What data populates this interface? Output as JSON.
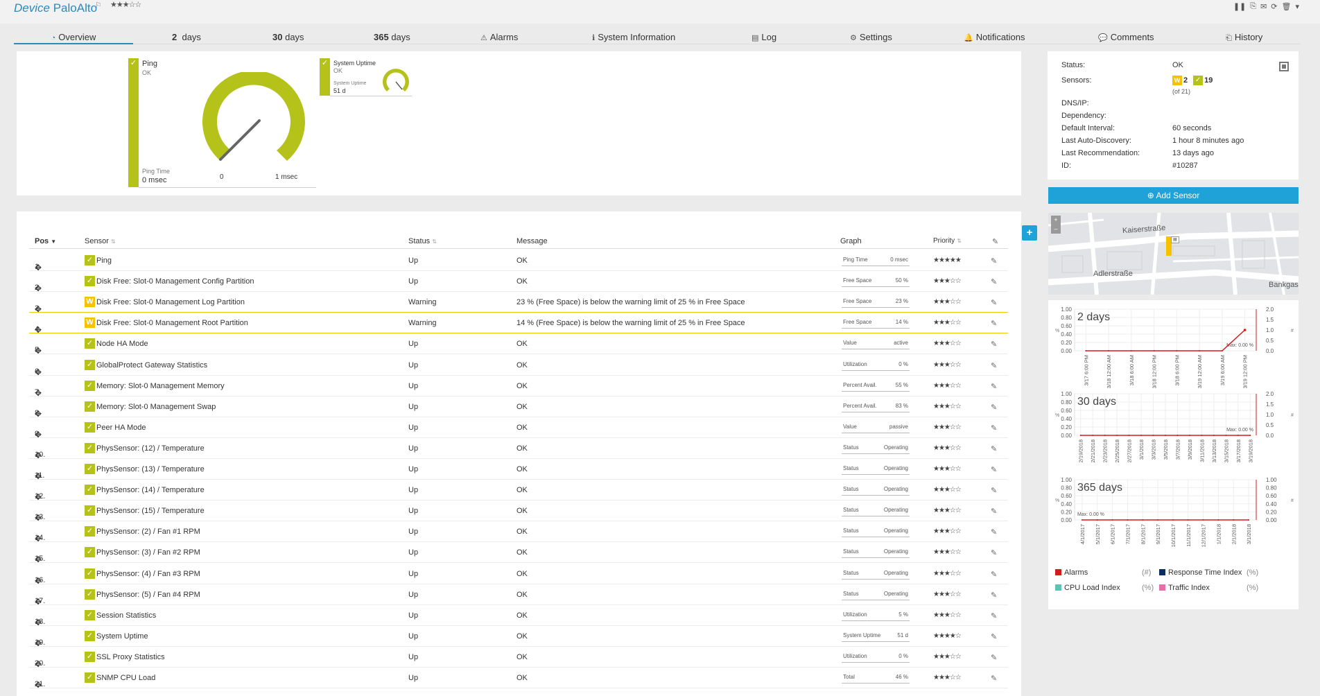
{
  "header": {
    "type_label": "Device",
    "device_name": "PaloAlto",
    "stars": "★★★☆☆",
    "tools": [
      "❚❚",
      "⎘",
      "✉",
      "⟳",
      "🗑",
      "▾"
    ]
  },
  "tabs": [
    {
      "icon": "◔",
      "label": "Overview"
    },
    {
      "icon": "",
      "num": "2",
      "label": "days"
    },
    {
      "icon": "",
      "num": "30",
      "label": "days"
    },
    {
      "icon": "",
      "num": "365",
      "label": "days"
    },
    {
      "icon": "⚠",
      "label": "Alarms"
    },
    {
      "icon": "ℹ",
      "label": "System Information"
    },
    {
      "icon": "▤",
      "label": "Log"
    },
    {
      "icon": "⚙",
      "label": "Settings"
    },
    {
      "icon": "🔔",
      "label": "Notifications"
    },
    {
      "icon": "💬",
      "label": "Comments"
    },
    {
      "icon": "⎗",
      "label": "History"
    }
  ],
  "gauges": {
    "ping": {
      "title": "Ping",
      "status": "OK",
      "channel": "Ping Time",
      "value": "0 msec",
      "min": "0",
      "max": "1 msec"
    },
    "uptime": {
      "title": "System Uptime",
      "status": "OK",
      "channel": "System Uptime",
      "value": "51 d"
    }
  },
  "table": {
    "headers": {
      "pos": "Pos",
      "sensor": "Sensor",
      "status": "Status",
      "message": "Message",
      "graph": "Graph",
      "priority": "Priority"
    },
    "rows": [
      {
        "pos": "1.",
        "state": "up",
        "name": "Ping",
        "status": "Up",
        "message": "OK",
        "channel": "Ping Time",
        "value": "0 msec",
        "prio": "★★★★★"
      },
      {
        "pos": "2.",
        "state": "up",
        "name": "Disk Free: Slot-0 Management Config Partition",
        "status": "Up",
        "message": "OK",
        "channel": "Free Space",
        "value": "50 %",
        "prio": "★★★☆☆"
      },
      {
        "pos": "3.",
        "state": "warning",
        "name": "Disk Free: Slot-0 Management Log Partition",
        "status": "Warning",
        "message": "23 % (Free Space) is below the warning limit of 25 % in Free Space",
        "channel": "Free Space",
        "value": "23 %",
        "prio": "★★★☆☆"
      },
      {
        "pos": "4.",
        "state": "warning",
        "name": "Disk Free: Slot-0 Management Root Partition",
        "status": "Warning",
        "message": "14 % (Free Space) is below the warning limit of 25 % in Free Space",
        "channel": "Free Space",
        "value": "14 %",
        "prio": "★★★☆☆"
      },
      {
        "pos": "5.",
        "state": "up",
        "name": "Node HA Mode",
        "status": "Up",
        "message": "OK",
        "channel": "Value",
        "value": "active",
        "prio": "★★★☆☆"
      },
      {
        "pos": "6.",
        "state": "up",
        "name": "GlobalProtect Gateway Statistics",
        "status": "Up",
        "message": "OK",
        "channel": "Utilization",
        "value": "0 %",
        "prio": "★★★☆☆"
      },
      {
        "pos": "7.",
        "state": "up",
        "name": "Memory: Slot-0 Management Memory",
        "status": "Up",
        "message": "OK",
        "channel": "Percent Avail.",
        "value": "55 %",
        "prio": "★★★☆☆"
      },
      {
        "pos": "8.",
        "state": "up",
        "name": "Memory: Slot-0 Management Swap",
        "status": "Up",
        "message": "OK",
        "channel": "Percent Avail.",
        "value": "83 %",
        "prio": "★★★☆☆"
      },
      {
        "pos": "9.",
        "state": "up",
        "name": "Peer HA Mode",
        "status": "Up",
        "message": "OK",
        "channel": "Value",
        "value": "passive",
        "prio": "★★★☆☆"
      },
      {
        "pos": "10.",
        "state": "up",
        "name": "PhysSensor: (12) / Temperature",
        "status": "Up",
        "message": "OK",
        "channel": "Status",
        "value": "Operating",
        "prio": "★★★☆☆"
      },
      {
        "pos": "11.",
        "state": "up",
        "name": "PhysSensor: (13) / Temperature",
        "status": "Up",
        "message": "OK",
        "channel": "Status",
        "value": "Operating",
        "prio": "★★★☆☆"
      },
      {
        "pos": "12.",
        "state": "up",
        "name": "PhysSensor: (14) / Temperature",
        "status": "Up",
        "message": "OK",
        "channel": "Status",
        "value": "Operating",
        "prio": "★★★☆☆"
      },
      {
        "pos": "13.",
        "state": "up",
        "name": "PhysSensor: (15) / Temperature",
        "status": "Up",
        "message": "OK",
        "channel": "Status",
        "value": "Operating",
        "prio": "★★★☆☆"
      },
      {
        "pos": "14.",
        "state": "up",
        "name": "PhysSensor: (2) / Fan #1 RPM",
        "status": "Up",
        "message": "OK",
        "channel": "Status",
        "value": "Operating",
        "prio": "★★★☆☆"
      },
      {
        "pos": "15.",
        "state": "up",
        "name": "PhysSensor: (3) / Fan #2 RPM",
        "status": "Up",
        "message": "OK",
        "channel": "Status",
        "value": "Operating",
        "prio": "★★★☆☆"
      },
      {
        "pos": "16.",
        "state": "up",
        "name": "PhysSensor: (4) / Fan #3 RPM",
        "status": "Up",
        "message": "OK",
        "channel": "Status",
        "value": "Operating",
        "prio": "★★★☆☆"
      },
      {
        "pos": "17.",
        "state": "up",
        "name": "PhysSensor: (5) / Fan #4 RPM",
        "status": "Up",
        "message": "OK",
        "channel": "Status",
        "value": "Operating",
        "prio": "★★★☆☆"
      },
      {
        "pos": "18.",
        "state": "up",
        "name": "Session Statistics",
        "status": "Up",
        "message": "OK",
        "channel": "Utilization",
        "value": "5 %",
        "prio": "★★★☆☆"
      },
      {
        "pos": "19.",
        "state": "up",
        "name": "System Uptime",
        "status": "Up",
        "message": "OK",
        "channel": "System Uptime",
        "value": "51 d",
        "prio": "★★★★☆"
      },
      {
        "pos": "20.",
        "state": "up",
        "name": "SSL Proxy Statistics",
        "status": "Up",
        "message": "OK",
        "channel": "Utilization",
        "value": "0 %",
        "prio": "★★★☆☆"
      },
      {
        "pos": "21.",
        "state": "up",
        "name": "SNMP CPU Load",
        "status": "Up",
        "message": "OK",
        "channel": "Total",
        "value": "46 %",
        "prio": "★★★☆☆"
      }
    ]
  },
  "info": {
    "status_label": "Status:",
    "status_value": "OK",
    "sensors_label": "Sensors:",
    "warn_count": "2",
    "up_count": "19",
    "of_total": "(of 21)",
    "dnsip_label": "DNS/IP:",
    "dependency_label": "Dependency:",
    "interval_label": "Default Interval:",
    "interval_value": "60 seconds",
    "autodisc_label": "Last Auto-Discovery:",
    "autodisc_value": "1 hour 8 minutes ago",
    "recommend_label": "Last Recommendation:",
    "recommend_value": "13 days ago",
    "id_label": "ID:",
    "id_value": "#10287"
  },
  "add_sensor_label": "Add Sensor",
  "map": {
    "street1": "Kaiserstraße",
    "street2": "Adlerstraße",
    "street3": "Bankgas"
  },
  "colors": {
    "up": "#b5c21a",
    "warning": "#f8c100",
    "accent": "#1fa2d8",
    "alarms": "#d7191c",
    "response": "#0b2d62",
    "cpu": "#56c6b5",
    "traffic": "#e66fa6"
  },
  "chart_data": [
    {
      "type": "line",
      "title": "2 days",
      "x": [
        "3/17 6:00 PM",
        "3/18 12:00 AM",
        "3/18 6:00 AM",
        "3/18 12:00 PM",
        "3/18 6:00 PM",
        "3/19 12:00 AM",
        "3/19 6:00 AM",
        "3/19 12:00 PM"
      ],
      "y_left_ticks": [
        "1.00",
        "0.80",
        "0.60",
        "0.40",
        "0.20",
        "0.00"
      ],
      "y_right_ticks": [
        "2.0",
        "1.5",
        "1.0",
        "0.5",
        "0.0"
      ],
      "ylabel_left": "%",
      "ylabel_right": "#",
      "max_label": "Max: 0.00 %",
      "series": [
        {
          "name": "Alarms",
          "values": [
            0,
            0,
            0,
            0,
            0,
            0,
            0,
            1
          ]
        }
      ]
    },
    {
      "type": "line",
      "title": "30 days",
      "x": [
        "2/19/2018",
        "2/21/2018",
        "2/23/2018",
        "2/25/2018",
        "2/27/2018",
        "3/1/2018",
        "3/3/2018",
        "3/5/2018",
        "3/7/2018",
        "3/9/2018",
        "3/11/2018",
        "3/13/2018",
        "3/15/2018",
        "3/17/2018",
        "3/19/2018"
      ],
      "y_left_ticks": [
        "1.00",
        "0.80",
        "0.60",
        "0.40",
        "0.20",
        "0.00"
      ],
      "y_right_ticks": [
        "2.0",
        "1.5",
        "1.0",
        "0.5",
        "0.0"
      ],
      "ylabel_left": "%",
      "ylabel_right": "#",
      "max_label": "Max: 0.00 %",
      "series": [
        {
          "name": "Alarms",
          "values": [
            0,
            0,
            0,
            0,
            0,
            0,
            0,
            0,
            0,
            0,
            0,
            0,
            0,
            0,
            0
          ]
        }
      ]
    },
    {
      "type": "line",
      "title": "365 days",
      "x": [
        "4/1/2017",
        "5/1/2017",
        "6/1/2017",
        "7/1/2017",
        "8/1/2017",
        "9/1/2017",
        "10/1/2017",
        "11/1/2017",
        "12/1/2017",
        "1/1/2018",
        "2/1/2018",
        "3/1/2018"
      ],
      "y_left_ticks": [
        "1.00",
        "0.80",
        "0.60",
        "0.40",
        "0.20",
        "0.00"
      ],
      "y_right_ticks": [
        "1.00",
        "0.80",
        "0.60",
        "0.40",
        "0.20",
        "0.00"
      ],
      "ylabel_left": "%",
      "ylabel_right": "#",
      "max_label": "Max: 0.00 %",
      "series": [
        {
          "name": "Alarms",
          "values": [
            0,
            0,
            0,
            0,
            0,
            0,
            0,
            0,
            0,
            0,
            0,
            0
          ]
        }
      ]
    }
  ],
  "legend": [
    {
      "name": "Alarms",
      "unit": "(#)",
      "color": "#d7191c"
    },
    {
      "name": "Response Time Index",
      "unit": "(%)",
      "color": "#0b2d62"
    },
    {
      "name": "CPU Load Index",
      "unit": "(%)",
      "color": "#56c6b5"
    },
    {
      "name": "Traffic Index",
      "unit": "(%)",
      "color": "#e66fa6"
    }
  ]
}
